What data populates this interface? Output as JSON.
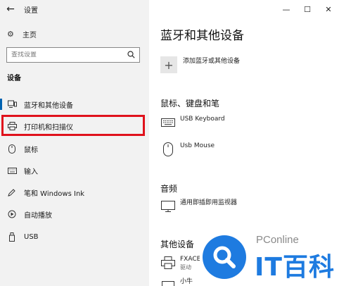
{
  "window": {
    "title": "设置",
    "back_icon": "arrow-left-icon",
    "controls": {
      "minimize": "—",
      "maximize": "☐",
      "close": "✕"
    }
  },
  "sidebar": {
    "home_label": "主页",
    "search_placeholder": "查找设置",
    "section_label": "设备",
    "items": [
      {
        "label": "蓝牙和其他设备",
        "icon": "bluetooth-devices-icon",
        "selected": true
      },
      {
        "label": "打印机和扫描仪",
        "icon": "printer-icon",
        "selected": false,
        "highlighted": true
      },
      {
        "label": "鼠标",
        "icon": "mouse-icon",
        "selected": false
      },
      {
        "label": "输入",
        "icon": "keyboard-icon",
        "selected": false
      },
      {
        "label": "笔和 Windows Ink",
        "icon": "pen-icon",
        "selected": false
      },
      {
        "label": "自动播放",
        "icon": "autoplay-icon",
        "selected": false
      },
      {
        "label": "USB",
        "icon": "usb-icon",
        "selected": false
      }
    ]
  },
  "main": {
    "title": "蓝牙和其他设备",
    "add_device_label": "添加蓝牙或其他设备",
    "groups": {
      "mouse_keyboard_pen": {
        "title": "鼠标、键盘和笔",
        "devices": [
          {
            "name": "USB Keyboard",
            "icon": "keyboard-icon"
          },
          {
            "name": "Usb Mouse",
            "icon": "mouse-icon"
          }
        ]
      },
      "audio": {
        "title": "音频",
        "devices": [
          {
            "name": "通用即插即用监视器",
            "icon": "monitor-icon"
          }
        ]
      },
      "other": {
        "title": "其他设备",
        "devices": [
          {
            "name": "FXACE",
            "sub": "驱动",
            "icon": "printer-icon"
          },
          {
            "name": "小牛",
            "icon": "device-icon"
          }
        ]
      }
    }
  },
  "watermark": {
    "brand": "PConline",
    "name": "IT百科"
  },
  "colors": {
    "accent": "#0063b1",
    "highlight": "#e0121c",
    "watermark_blue": "#1e7be0",
    "sidebar_bg": "#f2f2f2"
  }
}
